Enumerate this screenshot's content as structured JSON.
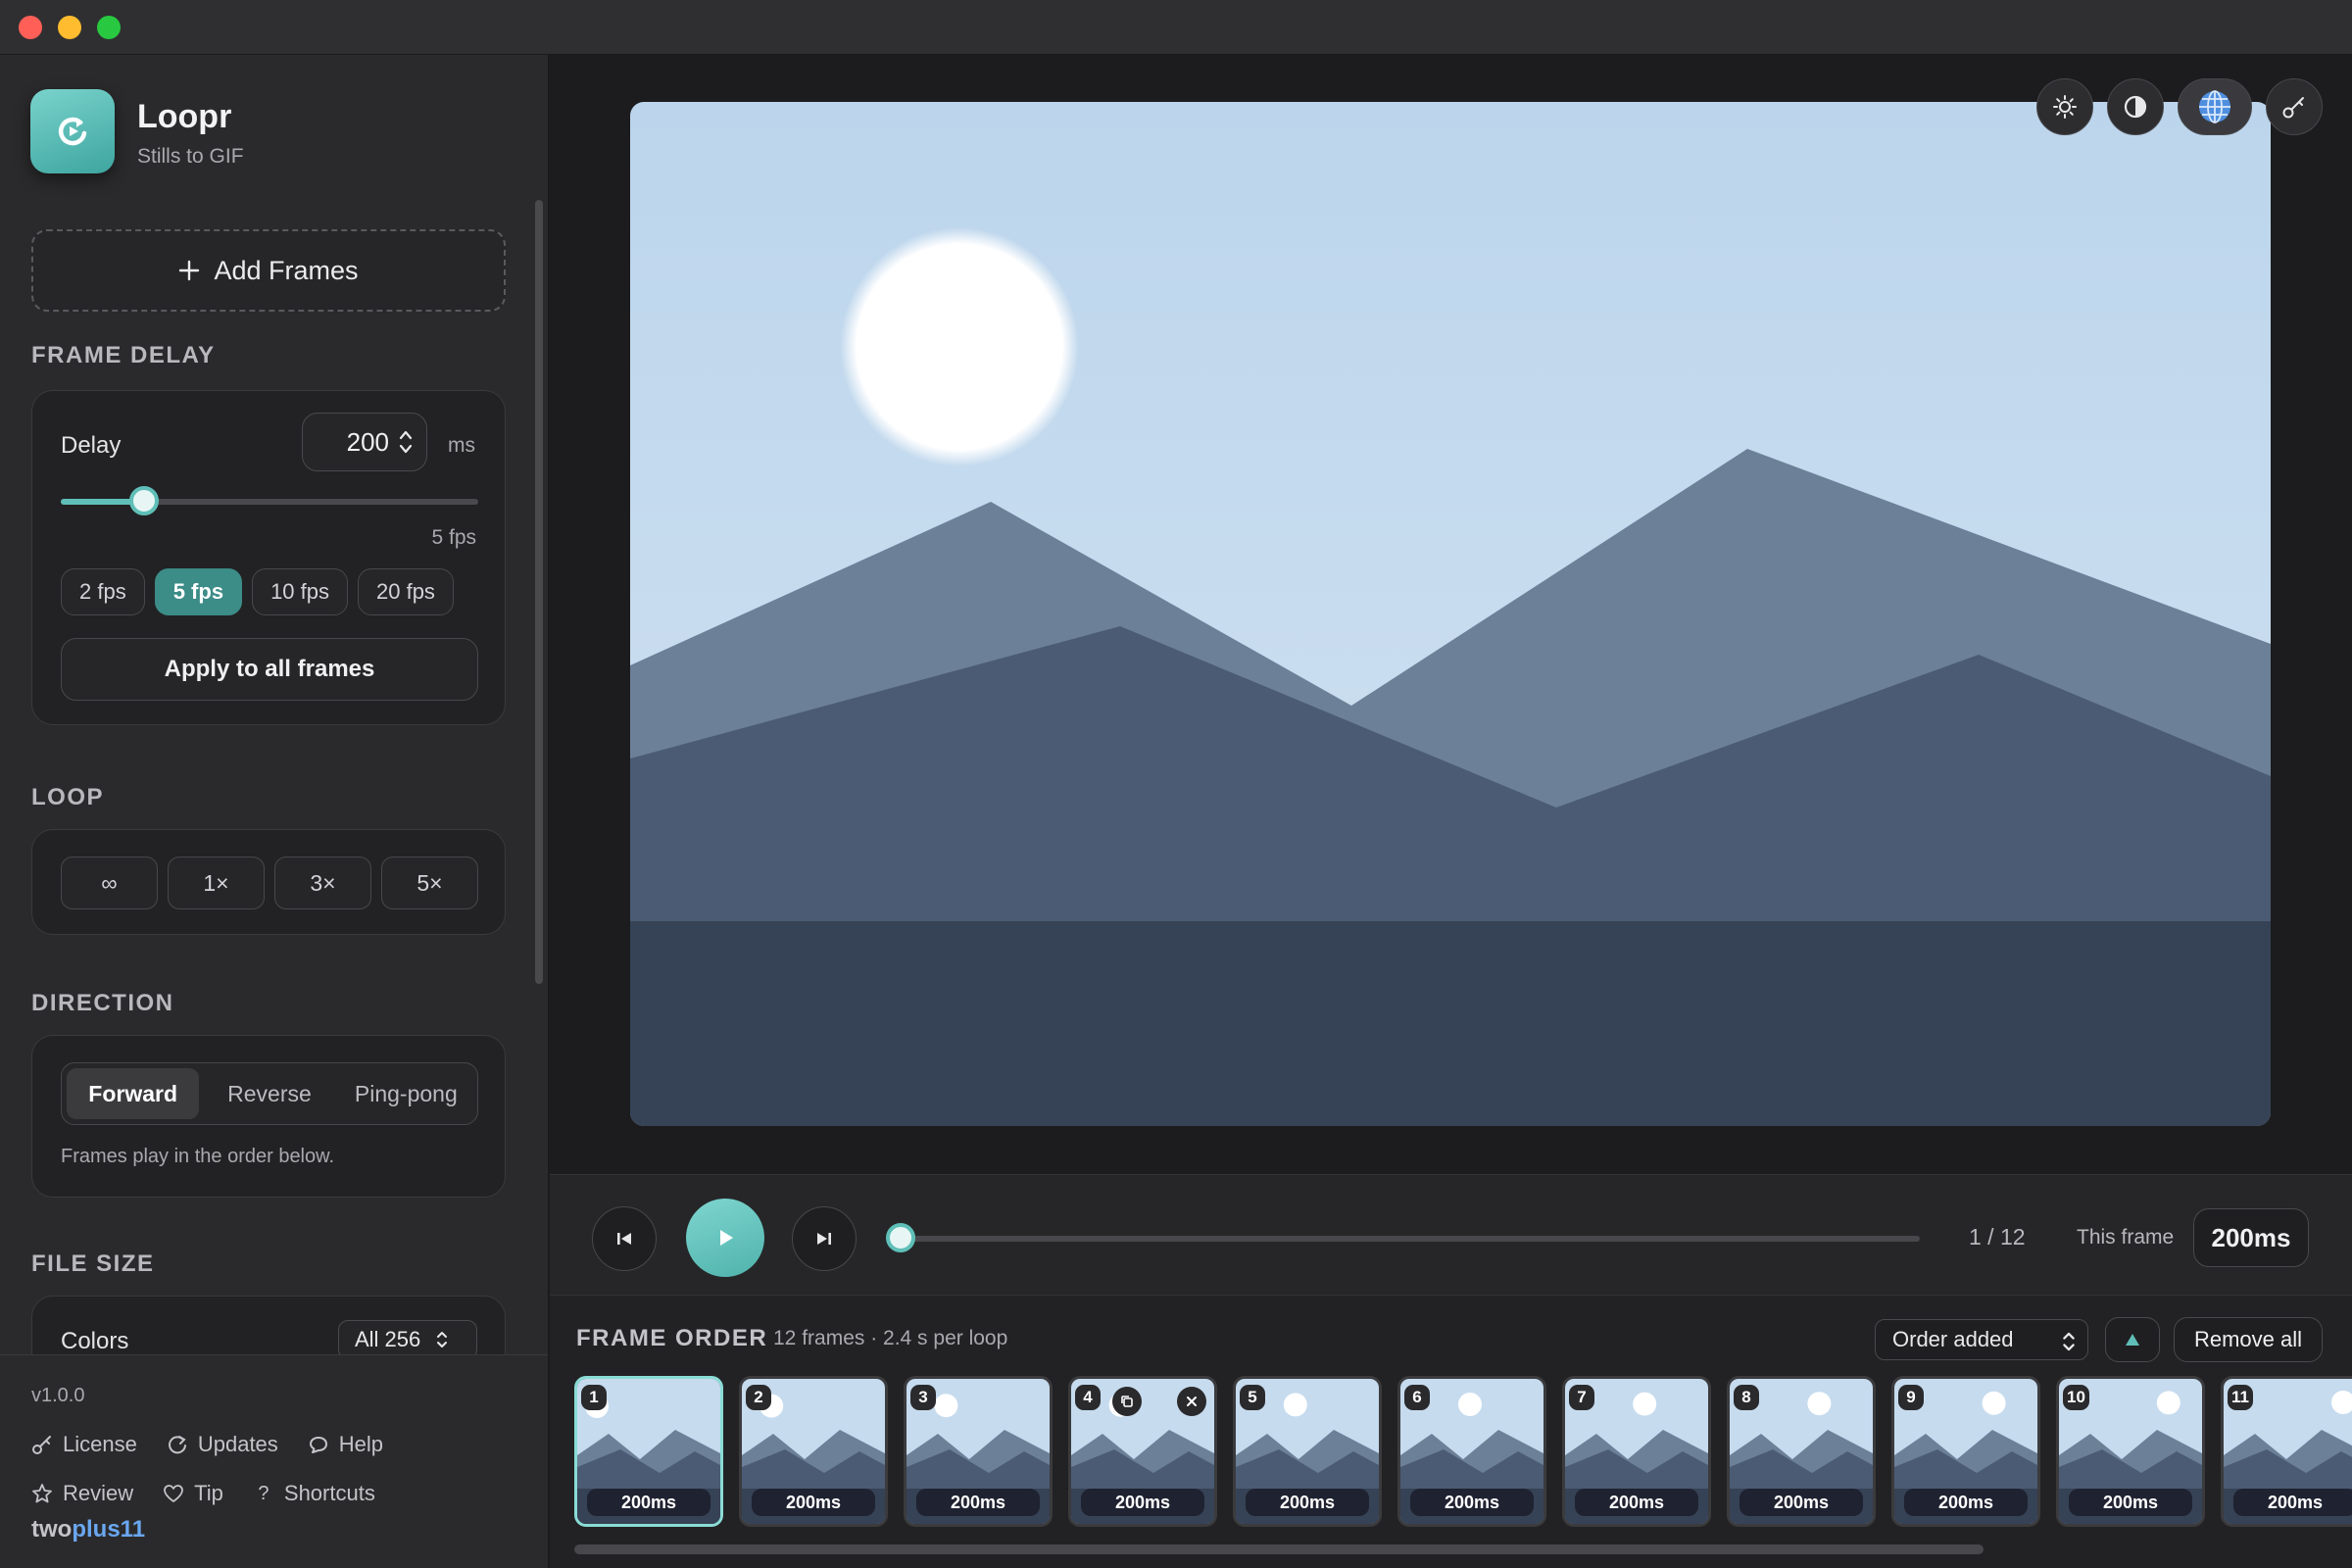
{
  "app": {
    "name": "Loopr",
    "subtitle": "Stills to GIF"
  },
  "sidebar": {
    "add_frames_label": "Add Frames",
    "frame_delay": {
      "section_title": "FRAME DELAY",
      "delay_label": "Delay",
      "delay_value": "200",
      "unit": "ms",
      "slider_fraction": 0.2,
      "fps_readout": "5 fps",
      "presets": [
        "2 fps",
        "5 fps",
        "10 fps",
        "20 fps"
      ],
      "active_preset": "5 fps",
      "apply_label": "Apply to all frames"
    },
    "loop": {
      "section_title": "LOOP",
      "options": [
        "∞",
        "1×",
        "3×",
        "5×"
      ]
    },
    "direction": {
      "section_title": "DIRECTION",
      "options": [
        "Forward",
        "Reverse",
        "Ping-pong"
      ],
      "active": "Forward",
      "hint": "Frames play in the order below."
    },
    "file_size": {
      "section_title": "FILE SIZE",
      "colors_label": "Colors",
      "colors_value": "All 256"
    },
    "footer": {
      "version": "v1.0.0",
      "links_row1": [
        "License",
        "Updates",
        "Help"
      ],
      "links_row2": [
        "Review",
        "Tip",
        "Shortcuts"
      ],
      "brand_prefix": "two",
      "brand_accent": "plus11"
    }
  },
  "preview": {
    "tools": [
      "brightness-icon",
      "contrast-icon",
      "globe-icon",
      "key-icon"
    ]
  },
  "transport": {
    "progress_fraction": 0,
    "frame_counter": "1 / 12",
    "this_frame_label": "This frame",
    "this_frame_value": "200ms"
  },
  "frame_order": {
    "title": "FRAME ORDER",
    "meta": "12 frames · 2.4 s per loop",
    "sort_select": "Order added",
    "remove_all_label": "Remove all",
    "frames": [
      {
        "num": "1",
        "delay": "200ms"
      },
      {
        "num": "2",
        "delay": "200ms"
      },
      {
        "num": "3",
        "delay": "200ms"
      },
      {
        "num": "4",
        "delay": "200ms"
      },
      {
        "num": "5",
        "delay": "200ms"
      },
      {
        "num": "6",
        "delay": "200ms"
      },
      {
        "num": "7",
        "delay": "200ms"
      },
      {
        "num": "8",
        "delay": "200ms"
      },
      {
        "num": "9",
        "delay": "200ms"
      },
      {
        "num": "10",
        "delay": "200ms"
      },
      {
        "num": "11",
        "delay": "200ms"
      }
    ],
    "selected_frame": "1",
    "hover_frame": "4"
  },
  "colors": {
    "accent": "#5fbfb8",
    "accent_dark": "#3c8c88",
    "sky_top": "#bcd5ec",
    "sky_bottom": "#d2e3f1",
    "mountain_back": "#6c8098",
    "mountain_front": "#4b5b74",
    "ground": "#364255"
  }
}
